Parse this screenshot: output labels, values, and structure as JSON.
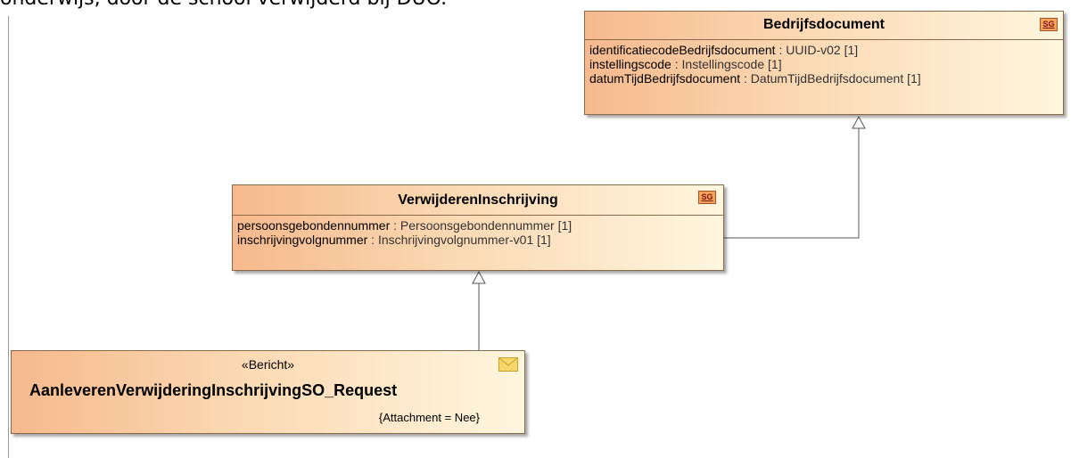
{
  "caption": "onderwijs, door de school verwijderd bij DUO.",
  "classes": {
    "bedrijfsdocument": {
      "name": "Bedrijfsdocument",
      "badge": "SG",
      "attributes": [
        {
          "name": "identificatiecodeBedrijfsdocument",
          "type": " : UUID-v02 [1]"
        },
        {
          "name": "instellingscode",
          "type": " : Instellingscode [1]"
        },
        {
          "name": "datumTijdBedrijfsdocument",
          "type": " : DatumTijdBedrijfsdocument [1]"
        }
      ]
    },
    "verwijderen": {
      "name": "VerwijderenInschrijving",
      "badge": "SG",
      "attributes": [
        {
          "name": "persoonsgebondennummer",
          "type": " : Persoonsgebondennummer [1]"
        },
        {
          "name": "inschrijvingvolgnummer",
          "type": " : Inschrijvingvolgnummer-v01 [1]"
        }
      ]
    },
    "request": {
      "stereotype": "«Bericht»",
      "name": "AanleverenVerwijderingInschrijvingSO_Request",
      "tagged_value": "{Attachment = Nee}",
      "icon": "envelope-icon"
    }
  },
  "colors": {
    "gradient_start": "#f6b98d",
    "gradient_end": "#fff6de",
    "border": "#8a6a4a"
  }
}
